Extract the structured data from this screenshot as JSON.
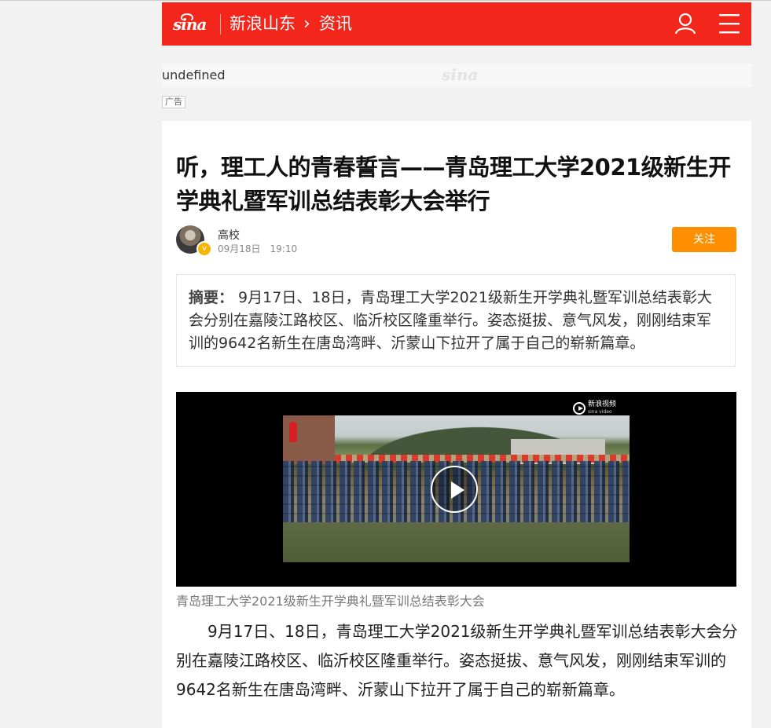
{
  "header": {
    "logo_text": "sina",
    "site_name": "新浪山东",
    "crumb_arrow": "›",
    "section": "资讯",
    "icons": [
      "user-icon",
      "menu-icon"
    ]
  },
  "ad": {
    "image_alt": "undefined",
    "watermark": "sina",
    "tag": "广告"
  },
  "article": {
    "title": "听，理工人的青春誓言——青岛理工大学2021级新生开学典礼暨军训总结表彰大会举行",
    "author": "高校",
    "date": "09月18日　19:10",
    "follow_label": "关注",
    "summary_label": "摘要：",
    "summary_text": " 9月17日、18日，青岛理工大学2021级新生开学典礼暨军训总结表彰大会分别在嘉陵江路校区、临沂校区隆重举行。姿态挺拔、意气风发，刚刚结束军训的9642名新生在唐岛湾畔、沂蒙山下拉开了属于自己的崭新篇章。",
    "video": {
      "brand": "新浪视频",
      "brand_sub": "sina video"
    },
    "caption": "青岛理工大学2021级新生开学典礼暨军训总结表彰大会",
    "body": "9月17日、18日，青岛理工大学2021级新生开学典礼暨军训总结表彰大会分别在嘉陵江路校区、临沂校区隆重举行。姿态挺拔、意气风发，刚刚结束军训的9642名新生在唐岛湾畔、沂蒙山下拉开了属于自己的崭新篇章。"
  },
  "colors": {
    "brand_red": "#f3261c",
    "follow_orange": "#ff8f00"
  }
}
